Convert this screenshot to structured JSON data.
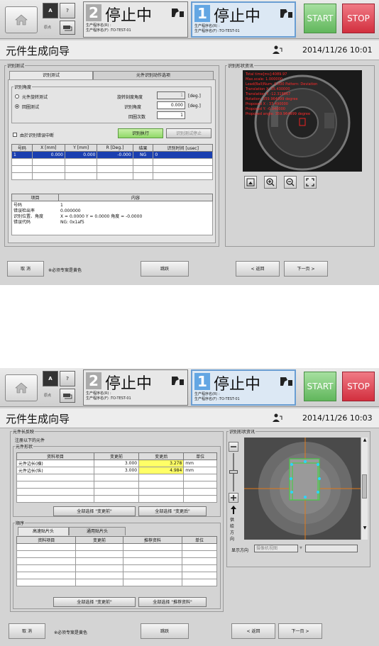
{
  "common": {
    "btn_a": "A",
    "btn_q": "?",
    "sub_a": "原点",
    "start": "START",
    "stop": "STOP",
    "status1_num": "2",
    "status1_text": "停止中",
    "status1_prog1": "生产程序名(R) :",
    "status1_prog2": "生产程序名(F) :TO-TEST-01",
    "status2_num": "1",
    "status2_text": "停止中",
    "status2_prog1": "生产程序名(R) :",
    "status2_prog2": "生产程序名(F) :TO-TEST-01",
    "title": "元件生成向导",
    "bottom": {
      "cancel": "取 消",
      "note": "※必须专案是黄色",
      "skip": "跳跃",
      "back": "< 返回",
      "next": "下一页 >"
    }
  },
  "screen1": {
    "datetime": "2014/11/26 10:01",
    "group_title": "识别测试",
    "tab1": "识别测试",
    "tab2": "元件识别动作选项",
    "angle_group": "识别角度",
    "radio1": "元件旋转测试",
    "radio2": "回圈测试",
    "rot_angle_label": "旋转刻度角度",
    "rot_angle_value": "1",
    "recog_angle_label": "识别角度",
    "recog_angle_value": "0.000",
    "loop_label": "回圈次数",
    "loop_value": "1",
    "unit_deg": "[deg.]",
    "stop_on_error": "由於识别错误中断",
    "btn_execute": "识别执行",
    "btn_stop_test": "识别测试停止",
    "results_headers": [
      "号码",
      "X [mm]",
      "Y [mm]",
      "R [Deg.]",
      "结果",
      "识别时间 [usec]"
    ],
    "results_rows": [
      [
        "1",
        "0.000",
        "0.000",
        "-0.000",
        "NG",
        "0"
      ]
    ],
    "detail_headers": [
      "项目",
      "内容"
    ],
    "details": [
      {
        "k": "号码",
        "v": "1"
      },
      {
        "k": "错误检出率",
        "v": "0.000000"
      },
      {
        "k": "识别位置、角度",
        "v": "X =   0.0000 Y =   0.0000 角度 =  -0.0000"
      },
      {
        "k": "错误代码",
        "v": "NG: 0x1af5"
      }
    ],
    "image_group": "识别形状资讯",
    "overlay": [
      "Total time[ms]:4089.97",
      "Max.scale: 1.000000",
      "Lead(Ball)Num: 0.000 Pattern: Deviation",
      "Translation X: 35.430000",
      "Translation Y: -12.318867",
      "Rotation: 359.964999 degree",
      "Proposed X : 33.490000",
      "Proposed Y: -0.040000",
      "Proposed angle: 359.964999 degree"
    ]
  },
  "screen2": {
    "datetime": "2014/11/26 10:03",
    "feedback_group": "元件长反映",
    "register_text": "注册以下的元件",
    "shape_group": "元件形状",
    "shape_headers": [
      "资料项目",
      "变更前",
      "变更后",
      "单位"
    ],
    "shape_rows": [
      [
        "元件边长(横)",
        "3.000",
        "3.278",
        "mm"
      ],
      [
        "元件边长(纵)",
        "3.000",
        "4.984",
        "mm"
      ]
    ],
    "btn_select_before": "全部选择 \"变更前\"",
    "btn_select_after": "全部选择 \"变更后\"",
    "order_group": "顺序",
    "tab1": "高速贴片头",
    "tab2": "通用贴片头",
    "order_headers": [
      "资料项目",
      "变更前",
      "推荐资料",
      "单位"
    ],
    "btn_select_before2": "全部选择 \"变更前\"",
    "btn_select_recommended": "全部选择 \"推荐资料\"",
    "image_group": "识别形状资讯",
    "supply_dir": "供给方向",
    "display_dir_label": "显示方向",
    "display_dir_value": "摄像机视图"
  }
}
